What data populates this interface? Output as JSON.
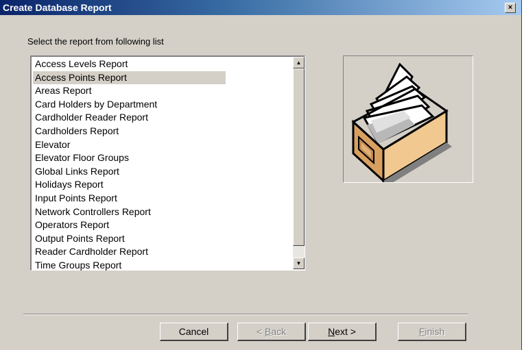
{
  "window": {
    "title": "Create Database Report",
    "close_glyph": "×"
  },
  "instruction": "Select the report from following list",
  "reports": [
    "Access Levels Report",
    "Access Points Report",
    "Areas Report",
    "Card Holders by Department",
    "Cardholder Reader Report",
    "Cardholders Report",
    "Elevator",
    "Elevator Floor Groups",
    "Global Links Report",
    "Holidays Report",
    "Input Points Report",
    "Network Controllers Report",
    "Operators Report",
    "Output Points Report",
    "Reader Cardholder Report",
    "Time Groups Report"
  ],
  "selected_report": "Access Points Report",
  "scrollbar": {
    "up_glyph": "▲",
    "down_glyph": "▼"
  },
  "picture_icon": "card-file-box-icon",
  "buttons": {
    "cancel": "Cancel",
    "back_prefix": "< ",
    "back_key": "B",
    "back_rest": "ack",
    "next_key": "N",
    "next_rest": "ext >",
    "finish_key": "F",
    "finish_rest": "inish"
  },
  "colors": {
    "face": "#d4d0c8",
    "titlebar_start": "#0a246a",
    "titlebar_end": "#a6caf0",
    "selection": "#d4d0c8"
  }
}
